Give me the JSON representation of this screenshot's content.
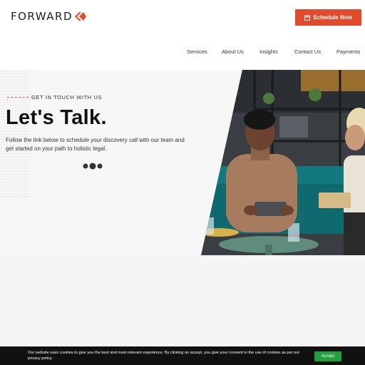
{
  "brand": {
    "name": "FORWARD",
    "accent": "#e24a2b"
  },
  "header": {
    "cta_label": "Schedule Now",
    "nav": [
      {
        "label": "Services"
      },
      {
        "label": "About Us"
      },
      {
        "label": "Insights"
      },
      {
        "label": "Contact Us"
      },
      {
        "label": "Payments"
      }
    ]
  },
  "hero": {
    "eyebrow": "GET IN TOUCH WITH US",
    "title": "Let's Talk.",
    "subtitle": "Follow the link below to schedule your discovery call with our team and get started on your path to holistic legal."
  },
  "cookie": {
    "text": "Our website uses cookies to give you the best and most relevant experience. By clicking on accept, you give your consent to the use of cookies as per our privacy policy.",
    "accept_label": "Accept",
    "accept_color": "#1fa03b"
  }
}
